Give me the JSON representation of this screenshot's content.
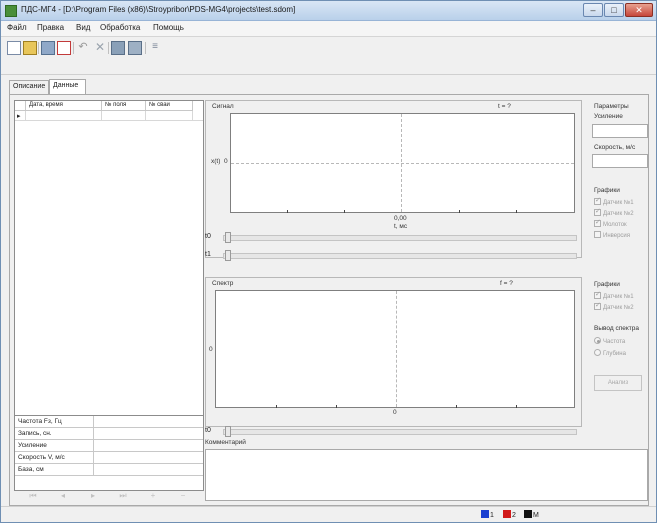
{
  "window": {
    "title": "ПДС-МГ4 - [D:\\Program Files (x86)\\Stroypribor\\PDS-MG4\\projects\\test.sdom]"
  },
  "menu": [
    "Файл",
    "Правка",
    "Вид",
    "Обработка",
    "Помощь"
  ],
  "tabs": [
    "Описание",
    "Данные"
  ],
  "grid": {
    "columns": [
      "",
      "Дата, время",
      "№ поля",
      "№ сваи"
    ],
    "row_pointer": "▸"
  },
  "properties": [
    {
      "label": "Частота Fз, Гц",
      "value": ""
    },
    {
      "label": "Запись, сн.",
      "value": ""
    },
    {
      "label": "Усиление",
      "value": ""
    },
    {
      "label": "Скорость V, м/с",
      "value": ""
    },
    {
      "label": "База, см",
      "value": ""
    }
  ],
  "signal": {
    "title": "Сигнал",
    "t_label": "t = ?",
    "y_label": "x(t)",
    "y_zero": "0",
    "x_value": "0,00",
    "x_unit": "t, мс"
  },
  "sliders": {
    "t0": "t0",
    "t1": "t1",
    "t2": "t0"
  },
  "spectrum": {
    "title": "Спектр",
    "f_label": "f = ?",
    "y_zero": "0",
    "x_zero": "0"
  },
  "right_panel": {
    "params_title": "Параметры",
    "gain_label": "Усиление",
    "gain_value": "",
    "speed_label": "Скорость, м/с",
    "speed_value": "",
    "graphs_title": "Графики",
    "graphs": [
      {
        "label": "Датчик №1",
        "checked": true
      },
      {
        "label": "Датчик №2",
        "checked": true
      },
      {
        "label": "Молоток",
        "checked": true
      },
      {
        "label": "Инверсия",
        "checked": false
      }
    ],
    "graphs2_title": "Графики",
    "graphs2": [
      {
        "label": "Датчик №1",
        "checked": true
      },
      {
        "label": "Датчик №2",
        "checked": true
      }
    ],
    "spectrum_out_title": "Вывод спектра",
    "spectrum_out": [
      {
        "label": "Частота",
        "selected": true
      },
      {
        "label": "Глубина",
        "selected": false
      }
    ],
    "analyze_label": "Анализ"
  },
  "comment": {
    "label": "Комментарий",
    "value": ""
  },
  "status": {
    "legend": [
      {
        "label": "1",
        "color": "#1a3fd1"
      },
      {
        "label": "2",
        "color": "#d11a1a"
      },
      {
        "label": "M",
        "color": "#111111"
      }
    ]
  }
}
